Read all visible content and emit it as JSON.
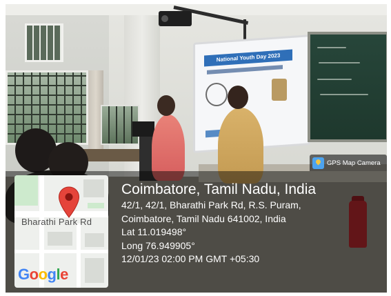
{
  "screen_slide": {
    "title": "National Youth Day 2023"
  },
  "gps_badge": {
    "app_name": "GPS Map Camera",
    "icon": "gps-map-camera-icon"
  },
  "map_thumbnail": {
    "street_label": "Bharathi Park Rd",
    "pin_icon": "map-pin-icon",
    "pin_color": "#e5443a",
    "logo_text": "Google"
  },
  "location": {
    "city": "Coimbatore, Tamil Nadu, India",
    "address_line1": "42/1, 42/1, Bharathi Park Rd, R.S. Puram,",
    "address_line2": "Coimbatore, Tamil Nadu 641002, India",
    "latitude": "Lat 11.019498°",
    "longitude": "Long 76.949905°",
    "datetime": "12/01/23 02:00 PM GMT +05:30"
  }
}
